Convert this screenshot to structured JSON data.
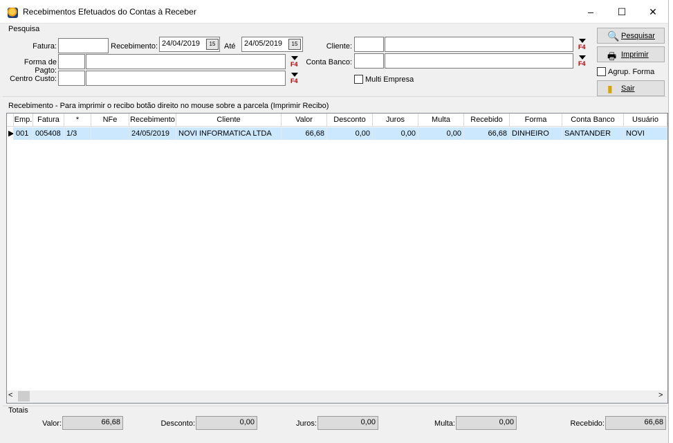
{
  "window": {
    "title": "Recebimentos Efetuados do Contas à Receber",
    "minimize": "–",
    "maximize": "☐",
    "close": "✕"
  },
  "pesquisa": {
    "caption": "Pesquisa",
    "fatura_label": "Fatura:",
    "fatura_value": "",
    "recebimento_label": "Recebimento:",
    "recebimento_from": "24/04/2019",
    "ate_label": "Até",
    "recebimento_to": "24/05/2019",
    "calendar_glyph": "15",
    "forma_label": "Forma de Pagto:",
    "centro_label": "Centro Custo:",
    "cliente_label": "Cliente:",
    "conta_label": "Conta Banco:",
    "multi_empresa_label": "Multi Empresa",
    "f4": "F4"
  },
  "buttons": {
    "pesquisar": "Pesquisar",
    "imprimir": "Imprimir",
    "agrup_forma": "Agrup. Forma",
    "sair": "Sair"
  },
  "grid": {
    "caption": "Recebimento - Para imprimir o recibo botão direito no mouse sobre a parcela (Imprimir Recibo)",
    "columns": [
      "Emp.",
      "Fatura",
      "*",
      "NFe",
      "Recebimento",
      "Cliente",
      "Valor",
      "Desconto",
      "Juros",
      "Multa",
      "Recebido",
      "Forma",
      "Conta Banco",
      "Usuário"
    ],
    "rows": [
      {
        "emp": "001",
        "fatura": "005408",
        "parcela": "1/3",
        "nfe": "",
        "recebimento": "24/05/2019",
        "cliente": "NOVI INFORMATICA LTDA",
        "valor": "66,68",
        "desconto": "0,00",
        "juros": "0,00",
        "multa": "0,00",
        "recebido": "66,68",
        "forma": "DINHEIRO",
        "conta": "SANTANDER",
        "usuario": "NOVI"
      }
    ],
    "scroll_left": "<",
    "scroll_right": ">"
  },
  "totais": {
    "caption": "Totais",
    "valor_label": "Valor:",
    "valor": "66,68",
    "desconto_label": "Desconto:",
    "desconto": "0,00",
    "juros_label": "Juros:",
    "juros": "0,00",
    "multa_label": "Multa:",
    "multa": "0,00",
    "recebido_label": "Recebido:",
    "recebido": "66,68"
  },
  "colors": {
    "selected_row": "#cce8ff",
    "f4_red": "#b00000"
  }
}
